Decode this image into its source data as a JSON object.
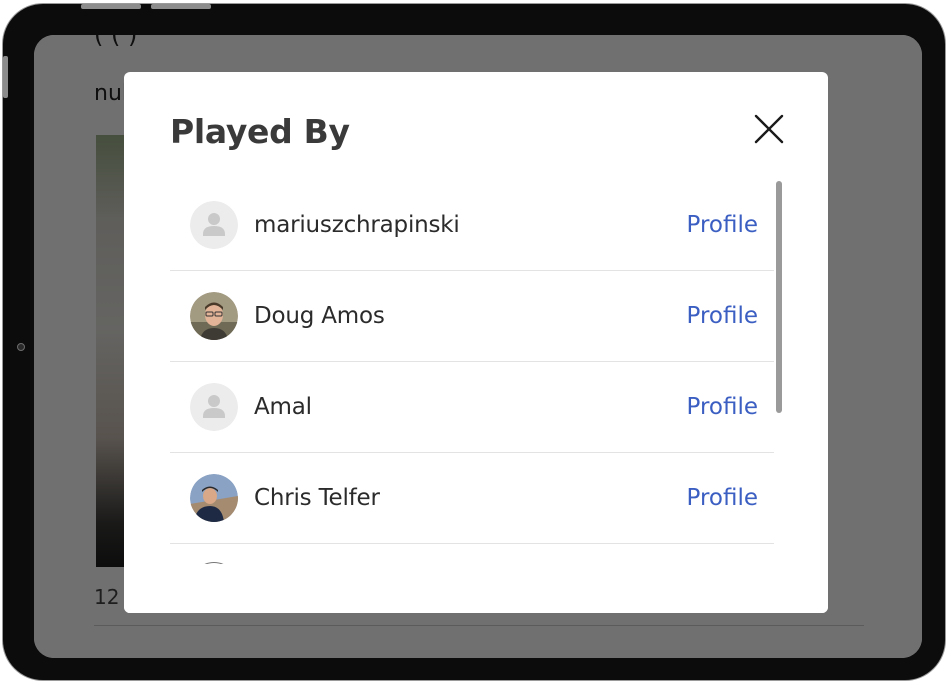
{
  "background": {
    "title_fragment": "(   (                )",
    "null_text": "nul",
    "count_text": "12"
  },
  "modal": {
    "title": "Played By",
    "close_icon": "close-x-icon",
    "players": [
      {
        "name": "mariuszchrapinski",
        "profile_label": "Profile",
        "avatar": "default-user-icon"
      },
      {
        "name": "Doug Amos",
        "profile_label": "Profile",
        "avatar": "photo"
      },
      {
        "name": "Amal",
        "profile_label": "Profile",
        "avatar": "default-user-icon"
      },
      {
        "name": "Chris Telfer",
        "profile_label": "Profile",
        "avatar": "photo"
      }
    ]
  },
  "colors": {
    "link": "#3b5ec2",
    "overlay": "rgba(0,0,0,0.56)",
    "frame": "#0c0c0c"
  }
}
